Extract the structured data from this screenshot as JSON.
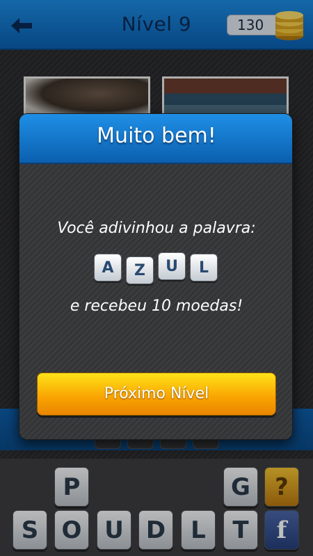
{
  "header": {
    "title": "Nível 9",
    "coins": "130"
  },
  "keyboard": {
    "row1": [
      "P",
      "",
      "",
      "",
      "",
      "G",
      "?"
    ],
    "row2": [
      "S",
      "O",
      "U",
      "D",
      "L",
      "T",
      "f"
    ]
  },
  "modal": {
    "title": "Muito bem!",
    "message": "Você adivinhou a palavra:",
    "word": [
      "A",
      "Z",
      "U",
      "L"
    ],
    "reward": "e recebeu 10 moedas!",
    "next_button": "Próximo Nível"
  },
  "colors": {
    "header_blue": "#0a5fb0",
    "button_yellow": "#f9a200"
  }
}
